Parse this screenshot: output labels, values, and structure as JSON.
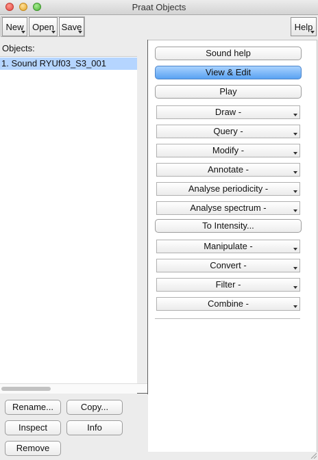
{
  "window": {
    "title": "Praat Objects"
  },
  "toolbar": {
    "new_label": "New",
    "open_label": "Open",
    "save_label": "Save",
    "help_label": "Help"
  },
  "objects": {
    "label": "Objects:",
    "items": [
      "1. Sound RYUf03_S3_001"
    ]
  },
  "actions": {
    "sound_help": "Sound help",
    "view_edit": "View & Edit",
    "play": "Play",
    "draw": "Draw -",
    "query": "Query -",
    "modify": "Modify -",
    "annotate": "Annotate -",
    "analyse_periodicity": "Analyse periodicity -",
    "analyse_spectrum": "Analyse spectrum -",
    "to_intensity": "To Intensity...",
    "manipulate": "Manipulate -",
    "convert": "Convert -",
    "filter": "Filter -",
    "combine": "Combine -"
  },
  "bottom": {
    "rename": "Rename...",
    "copy": "Copy...",
    "inspect": "Inspect",
    "info": "Info",
    "remove": "Remove"
  },
  "colors": {
    "selection": "#b5d5ff",
    "accent_button": "#5aa2f2"
  }
}
